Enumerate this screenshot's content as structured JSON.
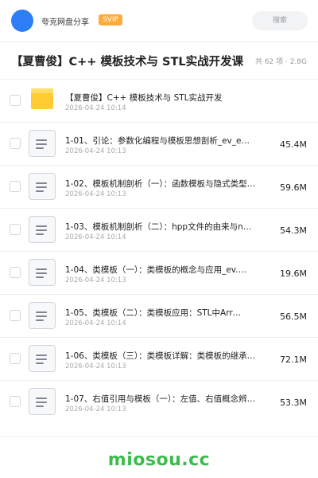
{
  "header": {
    "user_name": "夸克网盘分享",
    "badge": "SVIP",
    "search_placeholder": "搜索"
  },
  "folder": {
    "title": "【夏曹俊】C++ 模板技术与 STL实战开发课",
    "count": "共 62 项 · 2.8G"
  },
  "files": [
    {
      "name": "【夏曹俊】C++ 模板技术与 STL实战开发",
      "date": "2026-04-24 10:14",
      "size": "",
      "icon": "folder-icon"
    },
    {
      "name": "1-01、引论：参数化编程与模板思想剖析_ev_e…",
      "date": "2026-04-24 10:13",
      "size": "45.4M",
      "icon": "document-icon"
    },
    {
      "name": "1-02、模板机制剖析（一）：函数模板与隐式类型转…",
      "date": "2026-04-24 10:13",
      "size": "59.6M",
      "icon": "document-icon"
    },
    {
      "name": "1-03、模板机制剖析（二）：hpp文件的由来与n…",
      "date": "2026-04-24 10:14",
      "size": "54.3M",
      "icon": "document-icon"
    },
    {
      "name": "1-04、类模板（一）：类模板的概念与应用_ev.…",
      "date": "2026-04-24 10:13",
      "size": "19.6M",
      "icon": "document-icon"
    },
    {
      "name": "1-05、类模板（二）：类模板应用：STL中Arr…",
      "date": "2026-04-24 10:14",
      "size": "56.5M",
      "icon": "document-icon"
    },
    {
      "name": "1-06、类模板（三）：类模板详解：类模板的继承与…",
      "date": "2026-04-24 10:13",
      "size": "72.1M",
      "icon": "document-icon"
    },
    {
      "name": "1-07、右值引用与模板（一）：左值、右值概念辨析…",
      "date": "2026-04-24 10:13",
      "size": "53.3M",
      "icon": "document-icon"
    }
  ],
  "watermark": "miosou.cc"
}
